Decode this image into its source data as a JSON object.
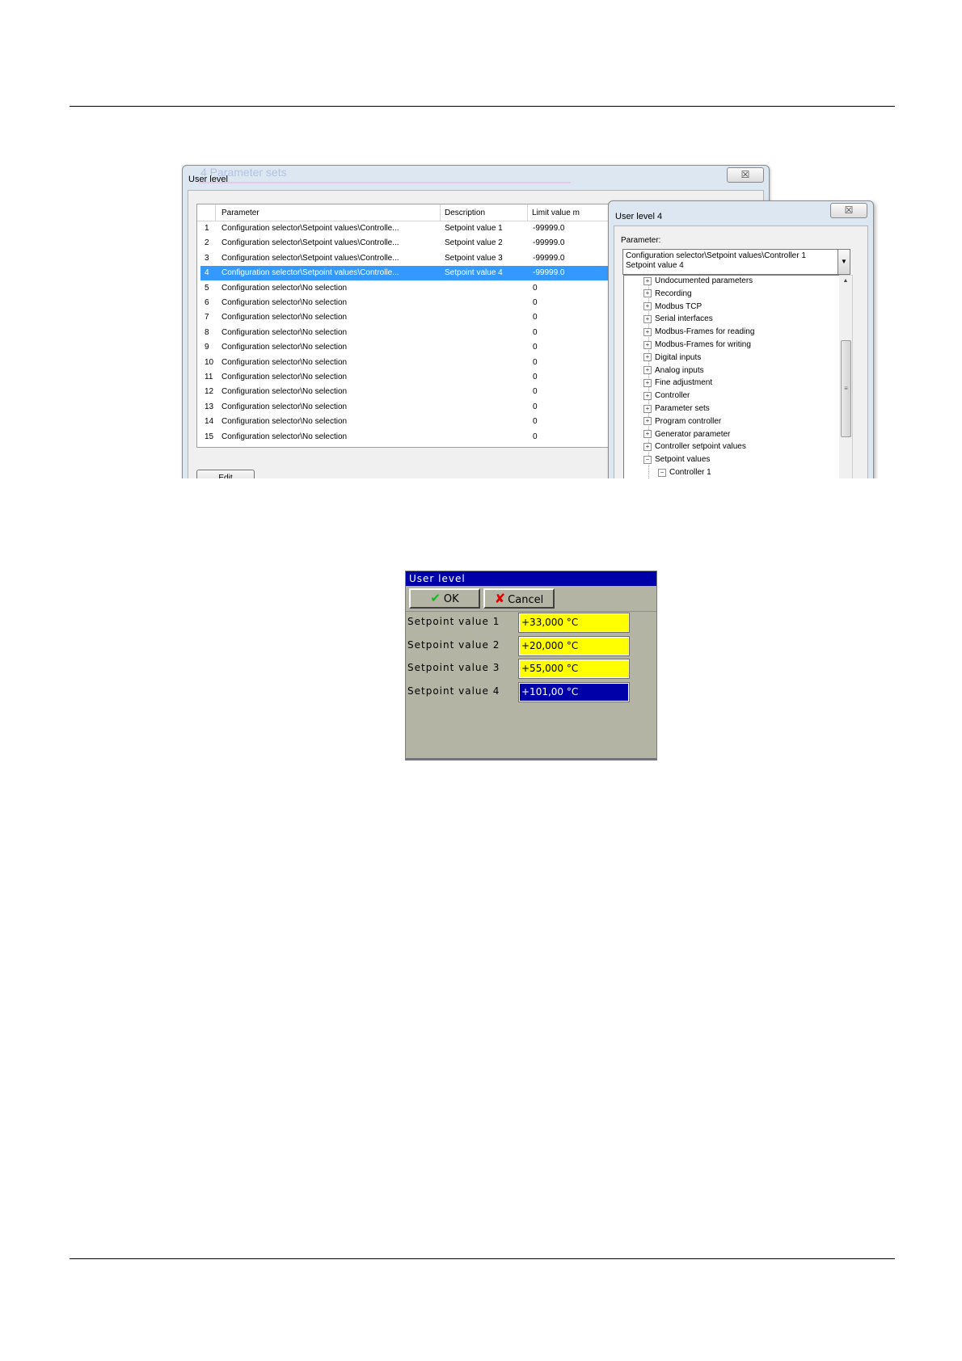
{
  "user_level_window": {
    "title": "User level",
    "ghost_title": "4 Parameter sets",
    "close_symbol": "☒",
    "columns": [
      "Parameter",
      "Description",
      "Limit value m"
    ],
    "rows": [
      {
        "no": "1",
        "parameter": "Configuration selector\\Setpoint values\\Controlle...",
        "description": "Setpoint value 1",
        "limit": "-99999.0"
      },
      {
        "no": "2",
        "parameter": "Configuration selector\\Setpoint values\\Controlle...",
        "description": "Setpoint value 2",
        "limit": "-99999.0"
      },
      {
        "no": "3",
        "parameter": "Configuration selector\\Setpoint values\\Controlle...",
        "description": "Setpoint value 3",
        "limit": "-99999.0"
      },
      {
        "no": "4",
        "parameter": "Configuration selector\\Setpoint values\\Controlle...",
        "description": "Setpoint value 4",
        "limit": "-99999.0"
      },
      {
        "no": "5",
        "parameter": "Configuration selector\\No selection",
        "description": "",
        "limit": "0"
      },
      {
        "no": "6",
        "parameter": "Configuration selector\\No selection",
        "description": "",
        "limit": "0"
      },
      {
        "no": "7",
        "parameter": "Configuration selector\\No selection",
        "description": "",
        "limit": "0"
      },
      {
        "no": "8",
        "parameter": "Configuration selector\\No selection",
        "description": "",
        "limit": "0"
      },
      {
        "no": "9",
        "parameter": "Configuration selector\\No selection",
        "description": "",
        "limit": "0"
      },
      {
        "no": "10",
        "parameter": "Configuration selector\\No selection",
        "description": "",
        "limit": "0"
      },
      {
        "no": "11",
        "parameter": "Configuration selector\\No selection",
        "description": "",
        "limit": "0"
      },
      {
        "no": "12",
        "parameter": "Configuration selector\\No selection",
        "description": "",
        "limit": "0"
      },
      {
        "no": "13",
        "parameter": "Configuration selector\\No selection",
        "description": "",
        "limit": "0"
      },
      {
        "no": "14",
        "parameter": "Configuration selector\\No selection",
        "description": "",
        "limit": "0"
      },
      {
        "no": "15",
        "parameter": "Configuration selector\\No selection",
        "description": "",
        "limit": "0"
      }
    ],
    "selected_row": 4,
    "edit_label": "Edit"
  },
  "user_level4_window": {
    "title": "User level 4",
    "close_symbol": "☒",
    "parameter_label": "Parameter:",
    "combo_line1": "Configuration selector\\Setpoint values\\Controller 1",
    "combo_line2": "Setpoint value 4",
    "combo_arrow": "▼",
    "tree_items": [
      {
        "label": "Undocumented parameters",
        "toggle": "+"
      },
      {
        "label": "Recording",
        "toggle": "+"
      },
      {
        "label": "Modbus TCP",
        "toggle": "+"
      },
      {
        "label": "Serial interfaces",
        "toggle": "+"
      },
      {
        "label": "Modbus-Frames for reading",
        "toggle": "+"
      },
      {
        "label": "Modbus-Frames for writing",
        "toggle": "+"
      },
      {
        "label": "Digital inputs",
        "toggle": "+"
      },
      {
        "label": "Analog inputs",
        "toggle": "+"
      },
      {
        "label": "Fine adjustment",
        "toggle": "+"
      },
      {
        "label": "Controller",
        "toggle": "+"
      },
      {
        "label": "Parameter sets",
        "toggle": "+"
      },
      {
        "label": "Program controller",
        "toggle": "+"
      },
      {
        "label": "Generator parameter",
        "toggle": "+"
      },
      {
        "label": "Controller setpoint values",
        "toggle": "+"
      },
      {
        "label": "Setpoint values",
        "toggle": "−"
      }
    ],
    "tree_child": {
      "label": "Controller 1",
      "toggle": "−"
    },
    "scroll_up": "▲",
    "scroll_grip": "≡"
  },
  "device_dialog": {
    "title": "User level",
    "ok_icon": "✔",
    "ok_label": "OK",
    "cancel_icon": "✘",
    "cancel_label": "Cancel",
    "fields": [
      {
        "label": "Setpoint value 1",
        "value": "+33,000 °C"
      },
      {
        "label": "Setpoint value 2",
        "value": "+20,000 °C"
      },
      {
        "label": "Setpoint value 3",
        "value": "+55,000 °C"
      },
      {
        "label": "Setpoint value 4",
        "value": "+101,00 °C"
      }
    ],
    "colors": {
      "title_bar": "#0000a8",
      "field": "#ffff00",
      "active_field": "#0000a8",
      "panel": "#b4b4a5"
    }
  }
}
